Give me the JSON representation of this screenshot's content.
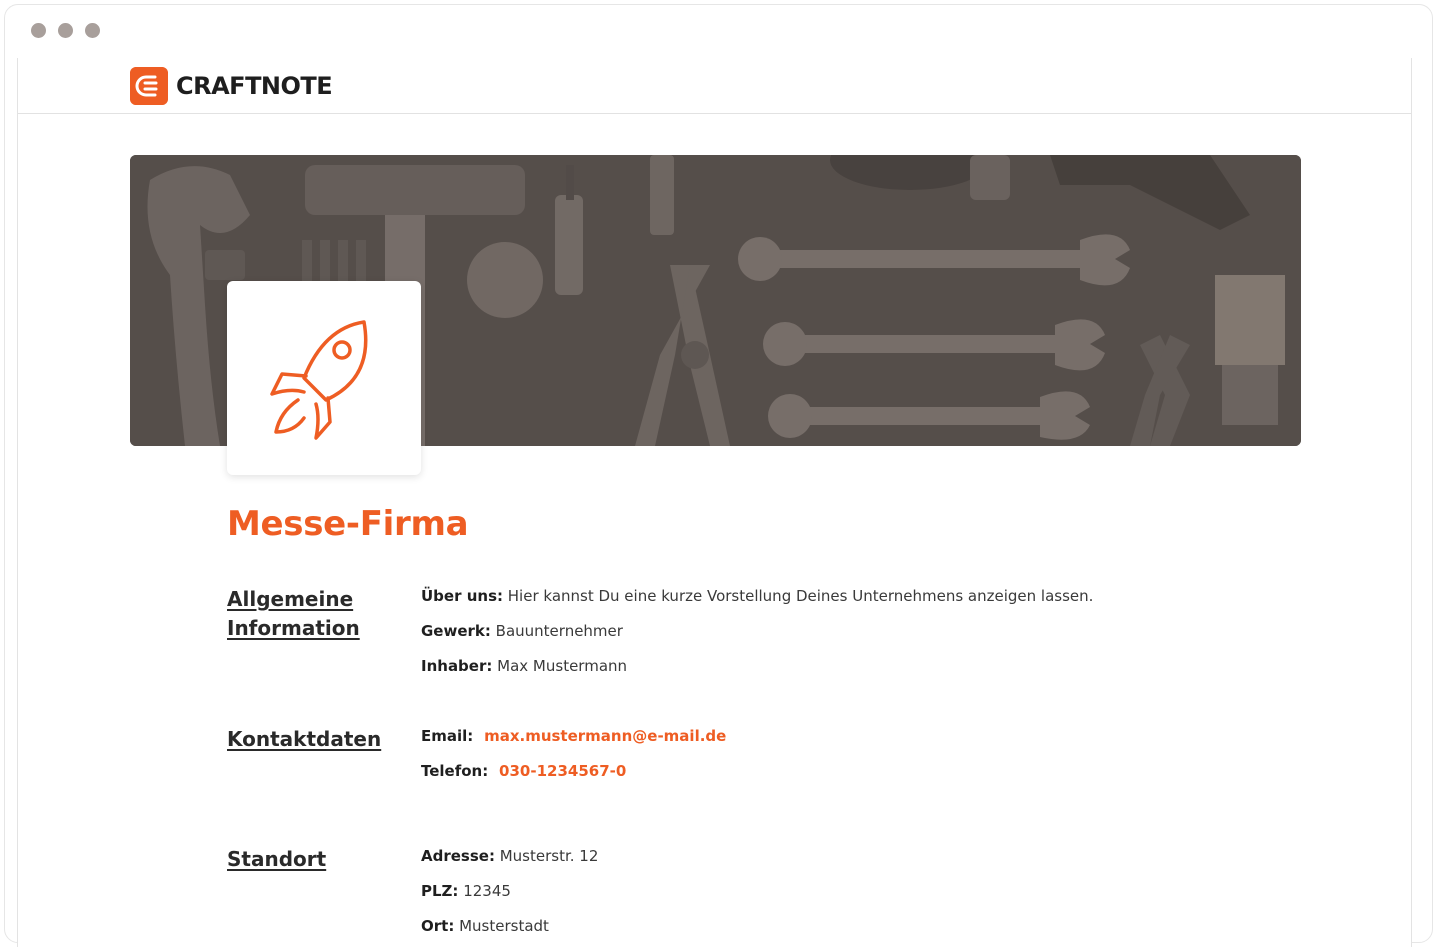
{
  "brand": {
    "name": "CRAFTNOTE",
    "accent": "#ee5d23"
  },
  "company": {
    "name": "Messe-Firma",
    "logo_icon": "rocket-icon"
  },
  "sections": {
    "general": {
      "title": "Allgemeine Information",
      "about_label": "Über uns:",
      "about_value": "Hier kannst Du eine kurze Vorstellung Deines Unternehmens anzeigen lassen.",
      "trade_label": "Gewerk:",
      "trade_value": "Bauunternehmer",
      "owner_label": "Inhaber:",
      "owner_value": "Max Mustermann"
    },
    "contact": {
      "title": "Kontaktdaten",
      "email_label": "Email:",
      "email_value": "max.mustermann@e-mail.de",
      "phone_label": "Telefon:",
      "phone_value": "030-1234567-0"
    },
    "location": {
      "title": "Standort",
      "address_label": "Adresse:",
      "address_value": "Musterstr. 12",
      "zip_label": "PLZ:",
      "zip_value": "12345",
      "city_label": "Ort:",
      "city_value": "Musterstadt"
    }
  }
}
